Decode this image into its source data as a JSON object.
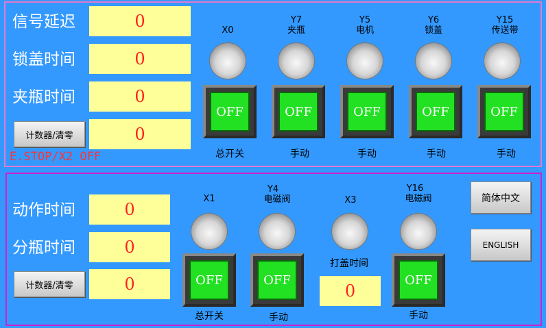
{
  "top": {
    "labels": [
      "信号延迟",
      "锁盖时间",
      "夹瓶时间"
    ],
    "values": [
      "0",
      "0",
      "0",
      "0"
    ],
    "counter_button": "计数器/清零",
    "estop_text": "E.STOP/X2  OFF",
    "indicators": [
      {
        "addr": "X0",
        "name": "",
        "switch": "OFF",
        "mode": "总开关"
      },
      {
        "addr": "Y7",
        "name": "夹瓶",
        "switch": "OFF",
        "mode": "手动"
      },
      {
        "addr": "Y5",
        "name": "电机",
        "switch": "OFF",
        "mode": "手动"
      },
      {
        "addr": "Y6",
        "name": "锁盖",
        "switch": "OFF",
        "mode": "手动"
      },
      {
        "addr": "Y15",
        "name": "传送带",
        "switch": "OFF",
        "mode": "手动"
      }
    ]
  },
  "bottom": {
    "labels": [
      "动作时间",
      "分瓶时间"
    ],
    "values": [
      "0",
      "0",
      "0"
    ],
    "counter_button": "计数器/清零",
    "indicators": [
      {
        "addr": "X1",
        "name": "",
        "switch": "OFF",
        "mode": "总开关"
      },
      {
        "addr": "Y4",
        "name": "电磁阀",
        "switch": "OFF",
        "mode": "手动"
      },
      {
        "addr": "X3",
        "name": "",
        "timer_label": "打盖时间",
        "timer_value": "0"
      },
      {
        "addr": "Y16",
        "name": "电磁阀",
        "switch": "OFF",
        "mode": "手动"
      }
    ],
    "lang_chinese": "简体中文",
    "lang_english": "ENGLISH"
  },
  "colors": {
    "background": "#3399ff",
    "value_box": "#ffff99",
    "value_text": "#ff2222",
    "switch_face": "#22e022",
    "estop_text": "#ff3333"
  }
}
